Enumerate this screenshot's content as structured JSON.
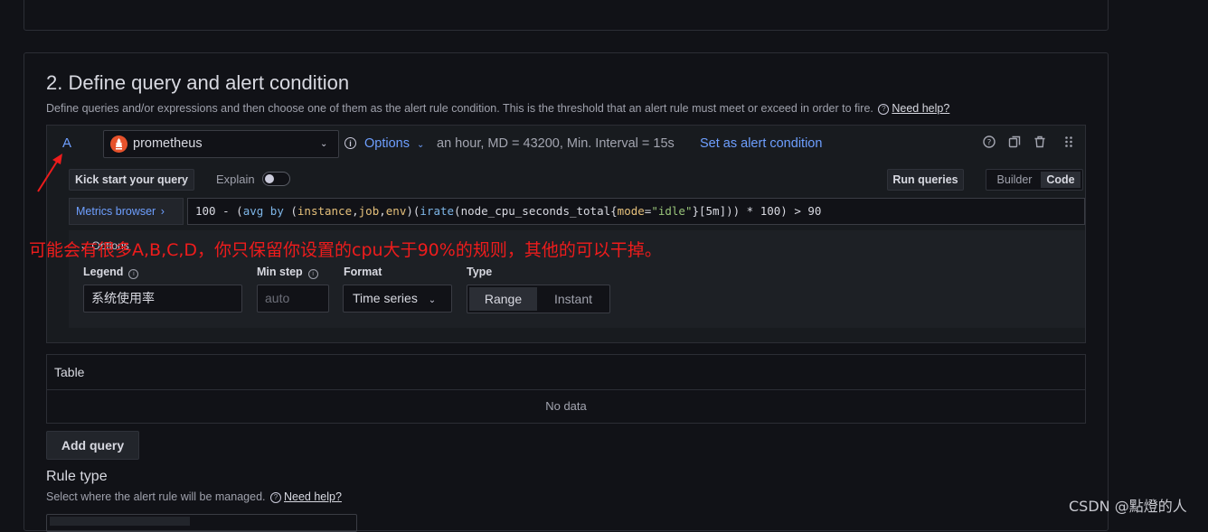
{
  "section": {
    "title": "2. Define query and alert condition",
    "description": "Define queries and/or expressions and then choose one of them as the alert rule condition. This is the threshold that an alert rule must meet or exceed in order to fire.",
    "help_link": "Need help?"
  },
  "query": {
    "ref_id": "A",
    "datasource": "prometheus",
    "options_label": "Options",
    "options_summary": "an hour, MD = 43200, Min. Interval = 15s",
    "set_alert_condition": "Set as alert condition",
    "kick_start": "Kick start your query",
    "explain_label": "Explain",
    "explain_enabled": false,
    "run_queries": "Run queries",
    "editor_modes": [
      "Builder",
      "Code"
    ],
    "active_mode": "Code",
    "metrics_browser": "Metrics browser",
    "expr_tokens": {
      "t1": "100 - (",
      "t2": "avg by",
      "t3": " (",
      "t4": "instance",
      "t5": ",",
      "t6": "job",
      "t7": ",",
      "t8": "env",
      "t9": ")(",
      "t10": "irate",
      "t11": "(node_cpu_seconds_total{",
      "t12": "mode",
      "t13": "=",
      "t14": "\"idle\"",
      "t15": "}[5m])) * 100) > 90"
    },
    "options_section": "Options",
    "legend_label": "Legend",
    "legend_value": "系统使用率",
    "min_step_label": "Min step",
    "min_step_placeholder": "auto",
    "format_label": "Format",
    "format_value": "Time series",
    "type_label": "Type",
    "type_options": [
      "Range",
      "Instant"
    ],
    "type_selected": "Range"
  },
  "table": {
    "title": "Table",
    "empty_text": "No data"
  },
  "add_query": "Add query",
  "rule_type": {
    "title": "Rule type",
    "description": "Select where the alert rule will be managed.",
    "help_link": "Need help?"
  },
  "annotation": {
    "text": "可能会有很多A,B,C,D，你只保留你设置的cpu大于90%的规则，其他的可以干掉。",
    "color": "#ee1c1c"
  },
  "watermark": "CSDN @點燈的人",
  "colors": {
    "accent": "#6e9fff",
    "background": "#111217",
    "panel": "#181b1f",
    "prometheus_logo": "#e6522c"
  }
}
